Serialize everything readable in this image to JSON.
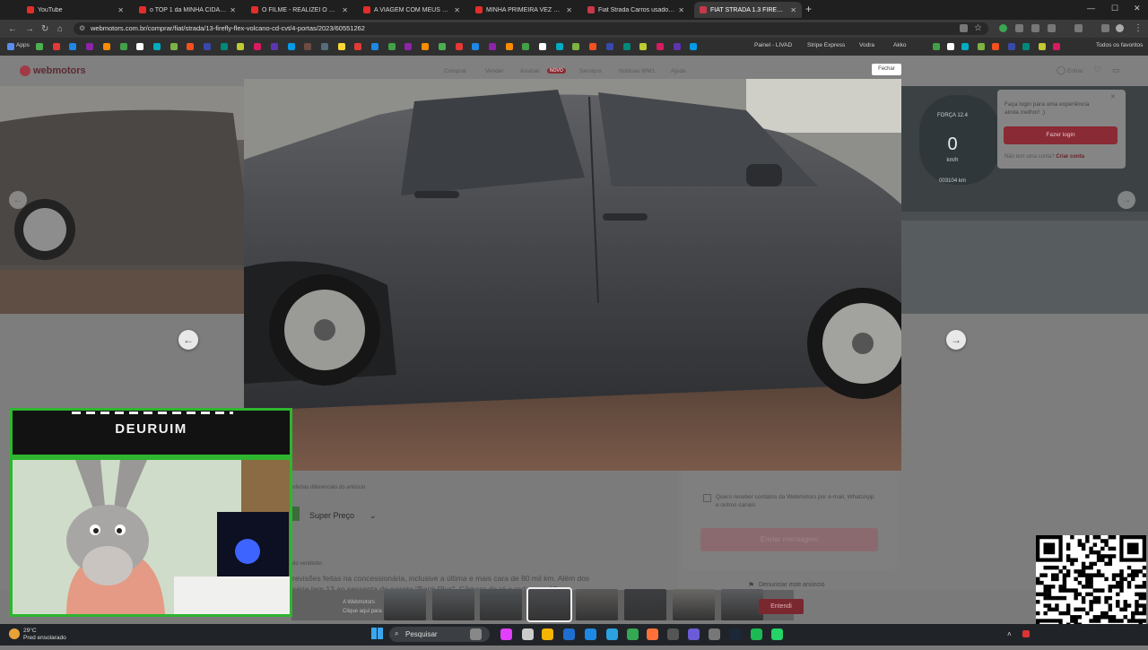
{
  "browser": {
    "tabs": [
      {
        "title": "YouTube",
        "color": "#e52d27"
      },
      {
        "title": "o TOP 1 da MINHA CIDADE? p",
        "color": "#e52d27"
      },
      {
        "title": "O FILME - REALIZEI O SONHO",
        "color": "#e52d27"
      },
      {
        "title": "A VIAGEM COM MEUS CAMER",
        "color": "#e52d27"
      },
      {
        "title": "MINHA PRIMEIRA VEZ PARTICI",
        "color": "#e52d27"
      },
      {
        "title": "Fiat Strada Carros usados, sen",
        "color": "#c8384a"
      },
      {
        "title": "FIAT STRADA 1.3 FIREFLY FLEX",
        "color": "#c8384a"
      }
    ],
    "url": "webmotors.com.br/comprar/fiat/strada/13-firefly-flex-volcano-cd-cvt/4-portas/2023/60551262",
    "bookmarks": {
      "apps": "Apps",
      "painel": "Painel - LIVAD",
      "stripe": "Stripe Express",
      "vodra": "Vodra",
      "akko": "Akko",
      "todos": "Todos os favoritos"
    }
  },
  "site": {
    "logo": "webmotors",
    "nav": [
      "Comprar",
      "Vender",
      "Assinar",
      "Serviços",
      "Notícias WM1",
      "Ajuda"
    ],
    "nav_badge": "NOVO",
    "entrar": "Entrar",
    "close": "Fechar",
    "login_popup": {
      "message": "Faça login para uma experiência ainda melhor! ;)",
      "button": "Fazer login",
      "no_account": "Não tem uma conta?",
      "create": "Criar conta"
    },
    "dashboard": {
      "speed": "0",
      "unit": "km/h",
      "odometer": "003104 km"
    },
    "favoritos_label": "ofertas diferenciais do anúncio",
    "super_preco": "Super Preço",
    "desc_label": "do vendedor",
    "description": "revisões feitas na concessionária, inclusive a última e mais cara de 80 mil km. Além dos",
    "description_2": "série tem 13 ao sessenta do pacote \"Bank Plus\". Câmera de ré e rodas aro 17 um",
    "receive": "Quero receber contatos da Webmotors por e-mail, WhatsApp e outros canais",
    "send": "Enviar mensagem",
    "report": "Denunciar este anúncio",
    "cookie_text_1": "A Webmotors",
    "cookie_text_2": "Clique aqui para",
    "entendi": "Entendi"
  },
  "overlay": {
    "streamer_name": "DEURUIM"
  },
  "taskbar": {
    "temp": "29°C",
    "weather": "Pred ensolarado",
    "search": "Pesquisar"
  }
}
